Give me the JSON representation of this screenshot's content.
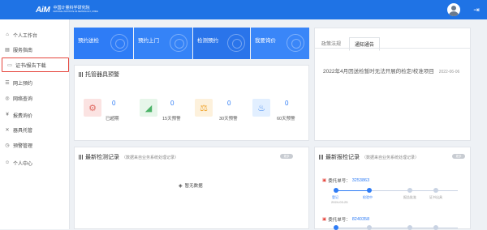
{
  "header": {
    "logo_mark": "AiM",
    "logo_text_cn": "中国计量科学研究院",
    "logo_text_en": "NATIONAL INSTITUTE OF METROLOGY, CHINA",
    "logout_icon": "logout-icon"
  },
  "sidebar": {
    "items": [
      {
        "icon": "home-icon",
        "glyph": "⌂",
        "label": "个人工作台"
      },
      {
        "icon": "book-icon",
        "glyph": "▤",
        "label": "服务指南"
      },
      {
        "icon": "certificate-icon",
        "glyph": "▭",
        "label": "证书/报告下载"
      },
      {
        "icon": "cart-icon",
        "glyph": "☰",
        "label": "网上预约"
      },
      {
        "icon": "query-icon",
        "glyph": "◎",
        "label": "网络查询"
      },
      {
        "icon": "yen-icon",
        "glyph": "¥",
        "label": "报费询价"
      },
      {
        "icon": "tools-icon",
        "glyph": "✕",
        "label": "器具托管"
      },
      {
        "icon": "alarm-icon",
        "glyph": "◷",
        "label": "预警管理"
      },
      {
        "icon": "user-icon",
        "glyph": "☺",
        "label": "个人中心"
      }
    ]
  },
  "tiles": [
    "预约送检",
    "预约上门",
    "检测预约",
    "我要询价"
  ],
  "device_alarm": {
    "title": "托管器具预警",
    "items": [
      {
        "icon": "expired-icon",
        "glyph": "⚙",
        "color": "#fbe3e2",
        "fg": "#e06b63",
        "value": "0",
        "label": "已超期"
      },
      {
        "icon": "ruler-icon",
        "glyph": "◢",
        "color": "#e7f6ea",
        "fg": "#4cb368",
        "value": "0",
        "label": "15天预警"
      },
      {
        "icon": "scale-icon",
        "glyph": "⚖",
        "color": "#fdf1dc",
        "fg": "#f0a733",
        "value": "0",
        "label": "30天预警"
      },
      {
        "icon": "thermometer-icon",
        "glyph": "🌡",
        "color": "#e2efff",
        "fg": "#4a8ef0",
        "value": "0",
        "label": "60天预警"
      }
    ]
  },
  "notices": {
    "tabs": [
      "政策法规",
      "通知通告"
    ],
    "active_tab": 1,
    "items": [
      {
        "text": "2022年4月因送检暂时无法开展的检定/校准项目",
        "date": "2022-06-06"
      }
    ]
  },
  "latest_tests": {
    "title": "最新检测记录",
    "subtitle": "（数据来自业务系统处理记录）",
    "more": "更多",
    "empty": "暂无数据"
  },
  "latest_reports": {
    "title": "最新报检记录",
    "subtitle": "（数据来自业务系统处理记录）",
    "more": "更多",
    "order_label": "委托单号：",
    "orders": [
      {
        "no": "3253863",
        "steps": [
          "登记",
          "检验中",
          "报告批准",
          "证书出具"
        ],
        "current": 1,
        "date": "2024-03-25"
      },
      {
        "no": "8240358"
      }
    ]
  }
}
